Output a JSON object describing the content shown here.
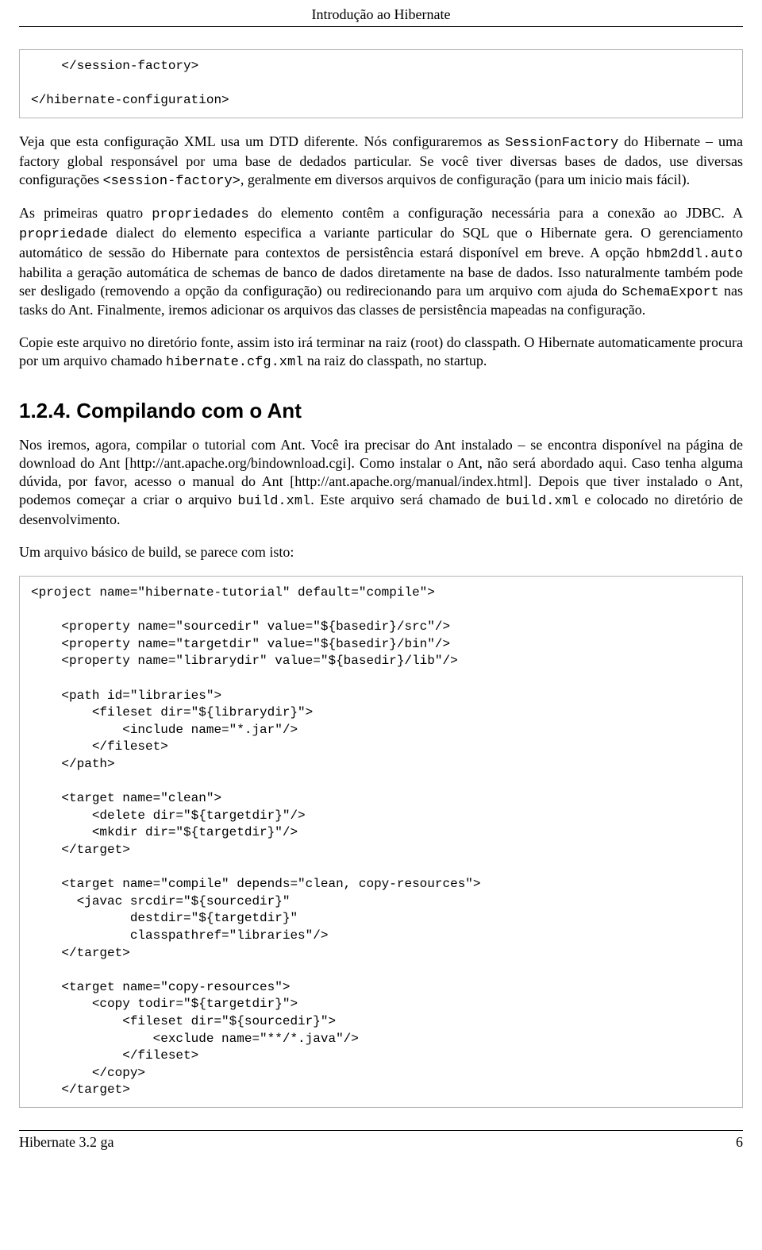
{
  "header": {
    "title": "Introdução ao Hibernate"
  },
  "code1": "    </session-factory>\n\n</hibernate-configuration>",
  "p1a": "Veja que esta configuração XML usa um DTD diferente. Nós configuraremos as ",
  "p1b": " do Hibernate – uma factory global responsável por uma base de dedados particular. Se você tiver diversas bases de dados, use diversas configurações ",
  "p1c": ", geralmente em diversos arquivos de configuração (para um inicio mais fácil).",
  "inlineSessionFactory": "SessionFactory",
  "inlineSessionFactoryTag": "<session-factory>",
  "p2a": "As primeiras quatro ",
  "p2b": " do elemento contêm a configuração necessária para a conexão ao JDBC. A ",
  "p2c": " dialect do elemento especifica a variante particular do SQL que o Hibernate gera. O gerenciamento automático de sessão do Hibernate para contextos de persistência estará disponível em breve. A opção ",
  "p2d": " habilita a geração automática de schemas de banco de dados diretamente na base de dados. Isso naturalmente também pode ser desligado (removendo a opção da configuração) ou redirecionando para um arquivo com ajuda do ",
  "p2e": " nas tasks do Ant. Finalmente, iremos adicionar os arquivos das classes de persistência mapeadas na configuração.",
  "inlinePropriedades": "propriedades",
  "inlinePropriedade": "propriedade",
  "inlineHbm2ddl": "hbm2ddl.auto",
  "inlineSchemaExport": "SchemaExport",
  "p3a": "Copie este arquivo no diretório fonte, assim isto irá terminar na raiz (root) do classpath. O Hibernate automaticamente procura por um arquivo chamado ",
  "p3b": " na raiz do classpath, no startup.",
  "inlineHibernateCfg": "hibernate.cfg.xml",
  "section": {
    "title": "1.2.4. Compilando com o Ant"
  },
  "p4a": "Nos iremos, agora, compilar o tutorial com Ant. Você ira precisar do Ant instalado – se encontra disponível na página de download do Ant [http://ant.apache.org/bindownload.cgi]. Como instalar o Ant, não será abordado aqui. Caso tenha alguma dúvida, por favor, acesso o manual do Ant [http://ant.apache.org/manual/index.html]. Depois que tiver instalado o Ant, podemos começar a criar o arquivo ",
  "p4b": ". Este arquivo será chamado de ",
  "p4c": " e colocado no diretório de desenvolvimento.",
  "inlineBuildXml": "build.xml",
  "p5": "Um arquivo básico de build, se parece com isto:",
  "code2": "<project name=\"hibernate-tutorial\" default=\"compile\">\n\n    <property name=\"sourcedir\" value=\"${basedir}/src\"/>\n    <property name=\"targetdir\" value=\"${basedir}/bin\"/>\n    <property name=\"librarydir\" value=\"${basedir}/lib\"/>\n\n    <path id=\"libraries\">\n        <fileset dir=\"${librarydir}\">\n            <include name=\"*.jar\"/>\n        </fileset>\n    </path>\n\n    <target name=\"clean\">\n        <delete dir=\"${targetdir}\"/>\n        <mkdir dir=\"${targetdir}\"/>\n    </target>\n\n    <target name=\"compile\" depends=\"clean, copy-resources\">\n      <javac srcdir=\"${sourcedir}\"\n             destdir=\"${targetdir}\"\n             classpathref=\"libraries\"/>\n    </target>\n\n    <target name=\"copy-resources\">\n        <copy todir=\"${targetdir}\">\n            <fileset dir=\"${sourcedir}\">\n                <exclude name=\"**/*.java\"/>\n            </fileset>\n        </copy>\n    </target>\n",
  "footer": {
    "left": "Hibernate 3.2 ga",
    "right": "6"
  }
}
